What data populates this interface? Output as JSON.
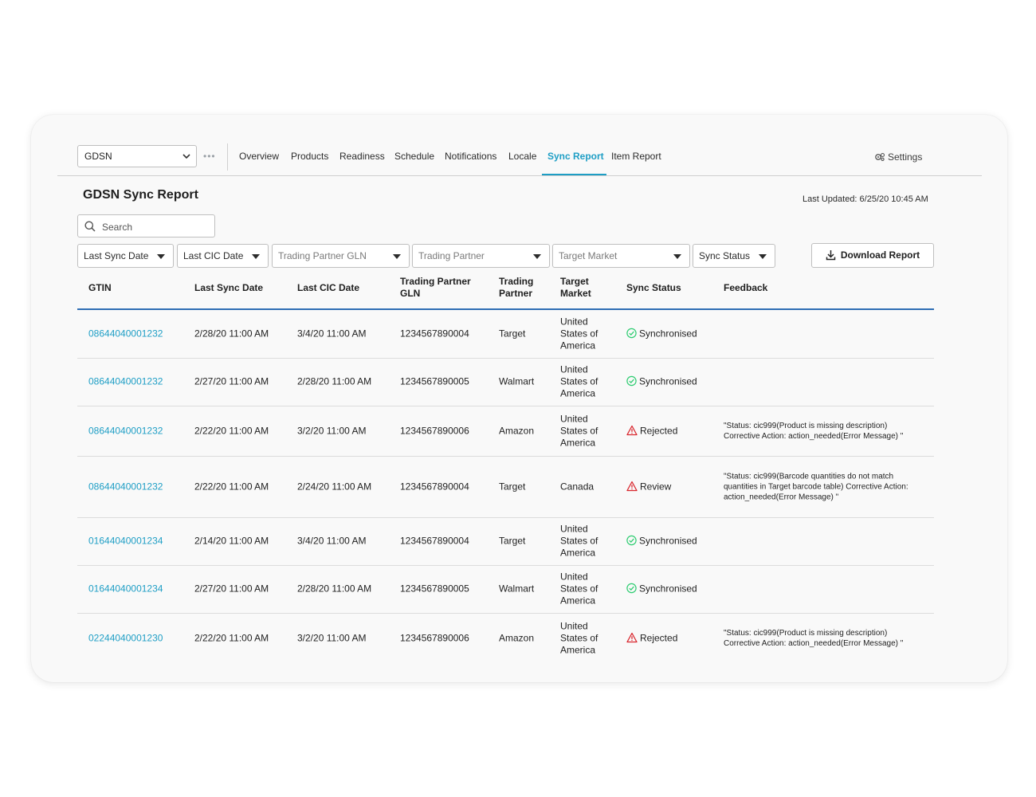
{
  "nav": {
    "dataset_value": "GDSN",
    "overflow": "•••",
    "items": [
      "Overview",
      "Products",
      "Readiness",
      "Schedule",
      "Notifications",
      "Locale",
      "Sync Report",
      "Item Report"
    ],
    "active": "Sync Report",
    "settings_label": "Settings"
  },
  "page": {
    "title": "GDSN Sync Report",
    "last_updated": "Last Updated: 6/25/20 10:45 AM"
  },
  "search": {
    "placeholder": "Search"
  },
  "filters": [
    "Last Sync Date",
    "Last CIC Date",
    "Trading Partner GLN",
    "Trading Partner",
    "Target Market",
    "Sync Status"
  ],
  "download_label": "Download Report",
  "table": {
    "columns": {
      "gtin": "GTIN",
      "last_sync": "Last Sync Date",
      "last_cic": "Last CIC Date",
      "gln": "Trading Partner GLN",
      "partner": "Trading Partner",
      "market": "Target Market",
      "status": "Sync Status",
      "feedback": "Feedback"
    },
    "rows": [
      {
        "gtin": "08644040001232",
        "last_sync": "2/28/20 11:00 AM",
        "last_cic": "3/4/20 11:00 AM",
        "gln": "1234567890004",
        "partner": "Target",
        "market": "United States of America",
        "status": "Synchronised",
        "status_icon": "check-circle-icon",
        "feedback": ""
      },
      {
        "gtin": "08644040001232",
        "last_sync": "2/27/20 11:00 AM",
        "last_cic": "2/28/20 11:00 AM",
        "gln": "1234567890005",
        "partner": "Walmart",
        "market": "United States of America",
        "status": "Synchronised",
        "status_icon": "check-circle-icon",
        "feedback": ""
      },
      {
        "gtin": "08644040001232",
        "last_sync": "2/22/20 11:00 AM",
        "last_cic": "3/2/20 11:00 AM",
        "gln": "1234567890006",
        "partner": "Amazon",
        "market": "United States of America",
        "status": "Rejected",
        "status_icon": "warning-triangle-icon",
        "feedback": "\"Status: cic999(Product is missing description) Corrective Action: action_needed(Error Message) \""
      },
      {
        "gtin": "08644040001232",
        "last_sync": "2/22/20 11:00 AM",
        "last_cic": "2/24/20 11:00 AM",
        "gln": "1234567890004",
        "partner": "Target",
        "market": "Canada",
        "status": "Review",
        "status_icon": "warning-triangle-icon",
        "feedback": "\"Status: cic999(Barcode quantities do not match quantities in Target barcode table) Corrective Action: action_needed(Error Message) \""
      },
      {
        "gtin": "01644040001234",
        "last_sync": "2/14/20 11:00 AM",
        "last_cic": "3/4/20 11:00 AM",
        "gln": "1234567890004",
        "partner": "Target",
        "market": "United States of America",
        "status": "Synchronised",
        "status_icon": "check-circle-icon",
        "feedback": ""
      },
      {
        "gtin": "01644040001234",
        "last_sync": "2/27/20 11:00 AM",
        "last_cic": "2/28/20 11:00 AM",
        "gln": "1234567890005",
        "partner": "Walmart",
        "market": "United States of America",
        "status": "Synchronised",
        "status_icon": "check-circle-icon",
        "feedback": ""
      },
      {
        "gtin": "02244040001230",
        "last_sync": "2/22/20 11:00 AM",
        "last_cic": "3/2/20 11:00 AM",
        "gln": "1234567890006",
        "partner": "Amazon",
        "market": "United States of America",
        "status": "Rejected",
        "status_icon": "warning-triangle-icon",
        "feedback": "\"Status: cic999(Product is missing description) Corrective Action: action_needed(Error Message) \""
      }
    ]
  },
  "colors": {
    "accent": "#1e9ec5",
    "header_rule": "#2e6db4",
    "success": "#2ecc71",
    "error": "#d9272e"
  }
}
